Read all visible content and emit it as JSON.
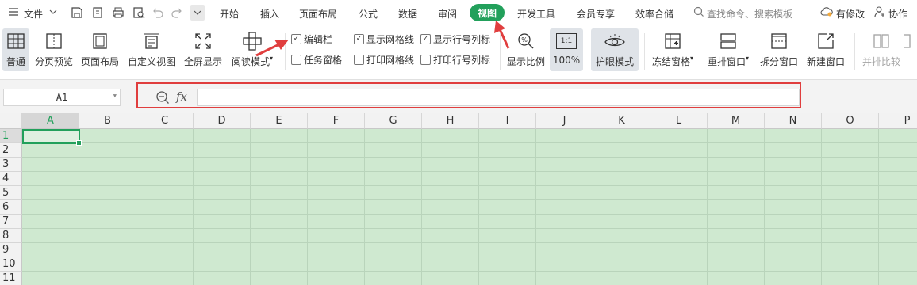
{
  "menubar": {
    "file_label": "文件",
    "tabs": [
      "开始",
      "插入",
      "页面布局",
      "公式",
      "数据",
      "审阅",
      "视图",
      "开发工具",
      "会员专享",
      "效率合储"
    ],
    "active_tab": "视图",
    "search_placeholder": "查找命令、搜索模板",
    "modified_label": "有修改",
    "collab_label": "协作"
  },
  "ribbon": {
    "buttons": {
      "normal": "普通",
      "page_break_preview": "分页预览",
      "page_layout": "页面布局",
      "custom_view": "自定义视图",
      "full_screen": "全屏显示",
      "reading_mode": "阅读模式",
      "zoom": "显示比例",
      "zoom_100": "100%",
      "zoom_100_icon": "1:1",
      "eye_protection": "护眼模式",
      "freeze_panes": "冻结窗格",
      "arrange_windows": "重排窗口",
      "split_window": "拆分窗口",
      "new_window": "新建窗口",
      "side_by_side": "并排比较"
    },
    "checkboxes": {
      "formula_bar": {
        "label": "编辑栏",
        "checked": true
      },
      "task_pane": {
        "label": "任务窗格",
        "checked": false
      },
      "show_gridlines": {
        "label": "显示网格线",
        "checked": true
      },
      "print_gridlines": {
        "label": "打印网格线",
        "checked": false
      },
      "show_headings": {
        "label": "显示行号列标",
        "checked": true
      },
      "print_headings": {
        "label": "打印行号列标",
        "checked": false
      }
    }
  },
  "formula_bar": {
    "name_box": "A1",
    "fx_label": "fx",
    "formula_value": ""
  },
  "sheet": {
    "columns": [
      "A",
      "B",
      "C",
      "D",
      "E",
      "F",
      "G",
      "H",
      "I",
      "J",
      "K",
      "L",
      "M",
      "N",
      "O",
      "P"
    ],
    "rows": [
      "1",
      "2",
      "3",
      "4",
      "5",
      "6",
      "7",
      "8",
      "9",
      "10",
      "11"
    ],
    "active_cell": "A1"
  },
  "colors": {
    "accent": "#22a05b",
    "annotation_red": "#e03e3e",
    "eye_protection_cell_bg": "#cfe9d0"
  }
}
